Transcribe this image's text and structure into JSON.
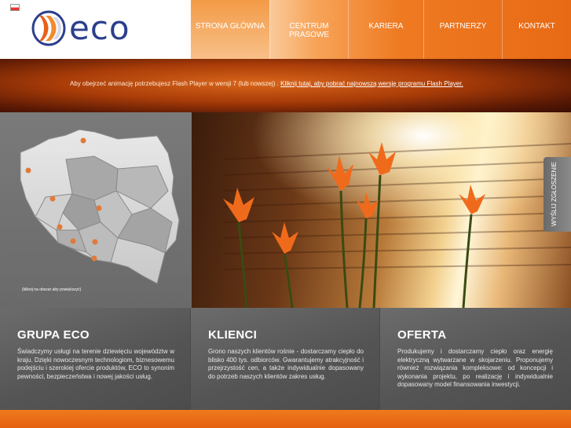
{
  "header": {
    "logo_text": "eco",
    "nav": [
      {
        "label": "STRONA GŁÓWNA",
        "active": true
      },
      {
        "label": "CENTRUM PRASOWE",
        "active": false
      },
      {
        "label": "KARIERA",
        "active": false
      },
      {
        "label": "PARTNERZY",
        "active": false
      },
      {
        "label": "KONTAKT",
        "active": false
      }
    ]
  },
  "flash_notice": {
    "text": "Aby obejrzeć animację potrzebujesz Flash Player w wersji 7 (lub nowszej) .",
    "link": "Kliknij tutaj, aby pobrać najnowszą wersję programu Flash Player."
  },
  "map": {
    "caption": "(kliknij na obszar aby powiększyć)"
  },
  "side_tab": {
    "label": "WYŚLIJ ZGŁOSZENIE"
  },
  "boxes": [
    {
      "title": "GRUPA ECO",
      "text": "Świadczymy usługi na terenie dziewięciu województw w kraju. Dzięki nowoczesnym technologiom, biznesowemu podejściu i szerokiej ofercie produktów, ECO to synonim pewności, bezpieczeństwa i nowej jakości usług."
    },
    {
      "title": "KLIENCI",
      "text": "Grono naszych klientów rośnie - dostarczamy ciepło do blisko 400 tys. odbiorców. Gwarantujemy atrakcyjność i przejrzystość cen, a także indywidualnie dopasowany do potrzeb naszych klientów zakres usług."
    },
    {
      "title": "OFERTA",
      "text": "Produkujemy i dostarczamy ciepło oraz energię elektryczną wytwarzane w skojarzeniu. Proponujemy również rozwiązania kompleksowe: od koncepcji i wykonania projektu, po realizację i indywidualnie dopasowany model finansowania inwestycji."
    }
  ],
  "colors": {
    "brand_orange": "#e86a14",
    "brand_blue": "#2b3f8c",
    "panel_grey": "#555555"
  }
}
